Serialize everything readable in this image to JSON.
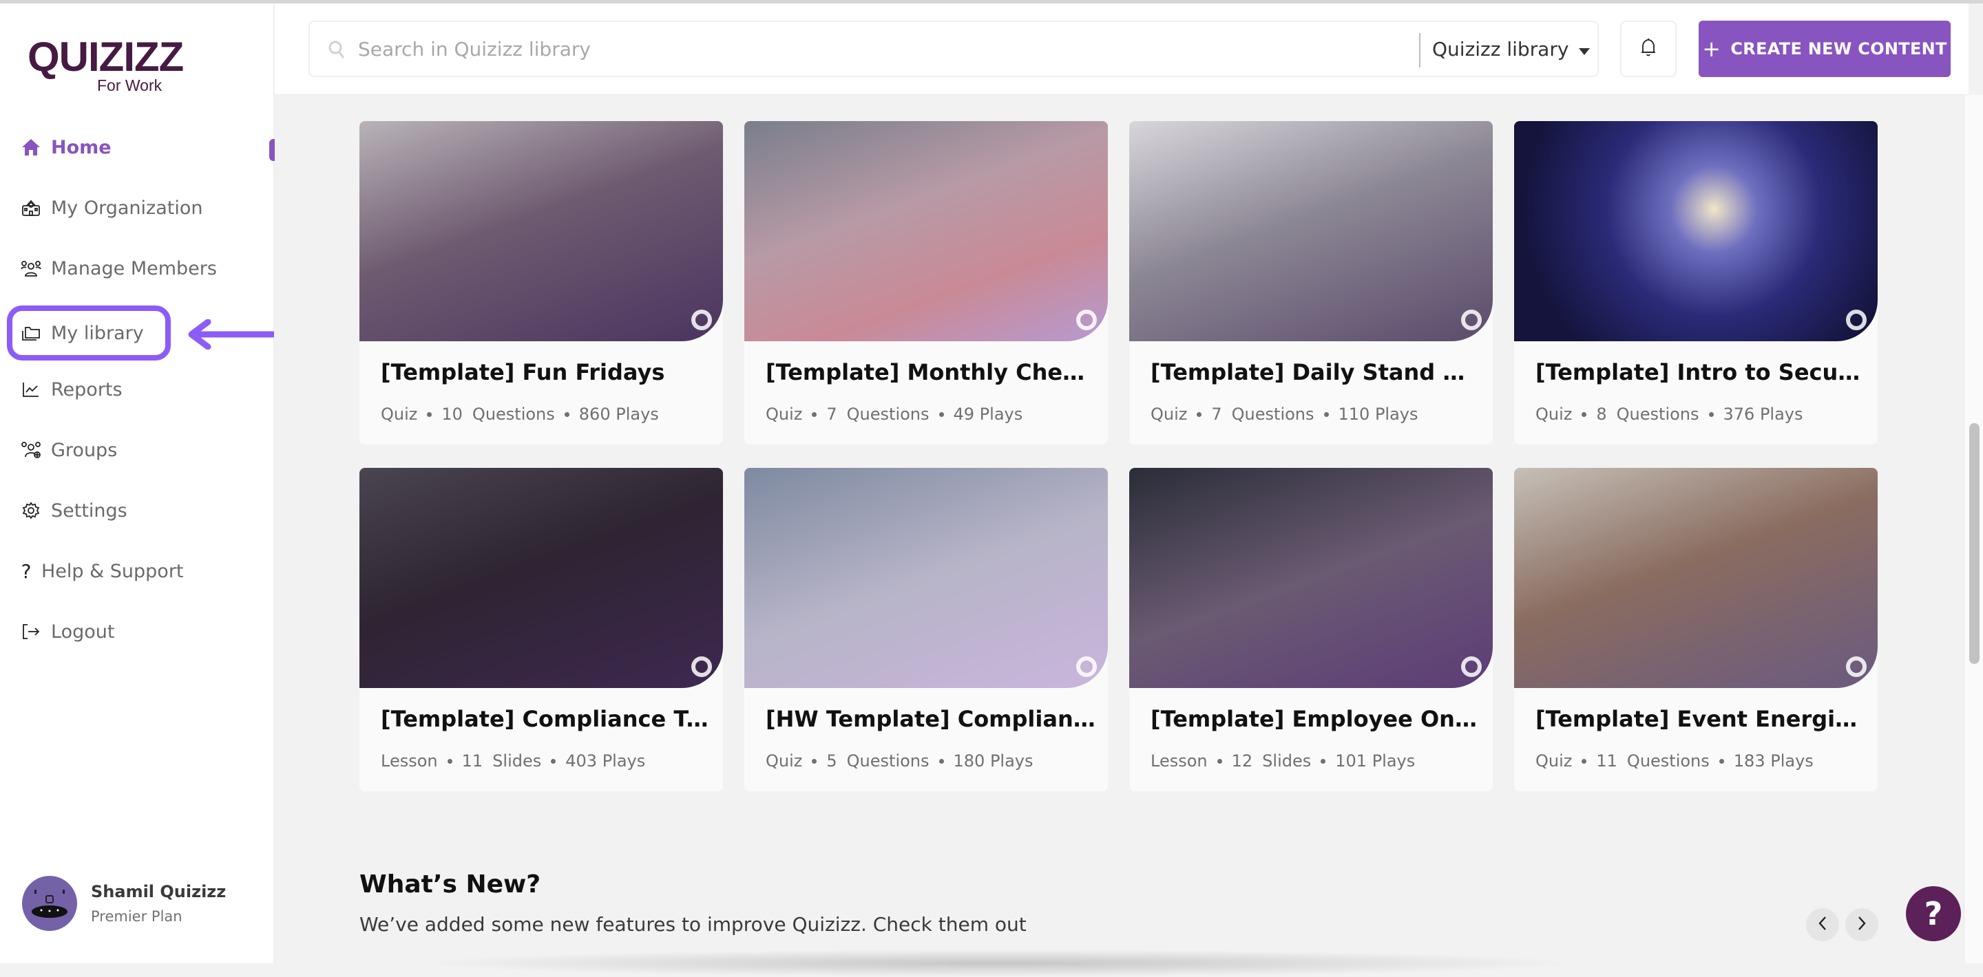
{
  "app": {
    "logo_main": "QUIZIZZ",
    "logo_sub": "For Work",
    "brand_color": "#8854c0",
    "logo_color": "#461a42"
  },
  "sidebar": {
    "items": [
      {
        "label": "Home",
        "icon": "home-icon",
        "active": true
      },
      {
        "label": "My Organization",
        "icon": "school-building-icon",
        "active": false
      },
      {
        "label": "Manage Members",
        "icon": "users-icon",
        "active": false
      },
      {
        "label": "My library",
        "icon": "folder-icon",
        "active": false
      },
      {
        "label": "Reports",
        "icon": "line-chart-icon",
        "active": false
      },
      {
        "label": "Groups",
        "icon": "group-add-icon",
        "active": false
      },
      {
        "label": "Settings",
        "icon": "gear-icon",
        "active": false
      },
      {
        "label": "Help & Support",
        "icon": "question-icon",
        "active": false
      },
      {
        "label": "Logout",
        "icon": "logout-icon",
        "active": false
      }
    ],
    "annotation_color": "#8c5cf6",
    "user": {
      "name": "Shamil Quizizz",
      "plan": "Premier Plan"
    }
  },
  "topbar": {
    "search_placeholder": "Search in Quizizz library",
    "search_value": "",
    "library_select": "Quizizz library",
    "create_label": "CREATE NEW CONTENT"
  },
  "cards": [
    {
      "title": "[Template] Fun Fridays",
      "type": "Quiz",
      "count": "10",
      "unit": "Questions",
      "plays": "860 Plays"
    },
    {
      "title": "[Template] Monthly Check in...",
      "type": "Quiz",
      "count": "7",
      "unit": "Questions",
      "plays": "49 Plays"
    },
    {
      "title": "[Template] Daily Stand Ups",
      "type": "Quiz",
      "count": "7",
      "unit": "Questions",
      "plays": "110 Plays"
    },
    {
      "title": "[Template] Intro to Security ...",
      "type": "Quiz",
      "count": "8",
      "unit": "Questions",
      "plays": "376 Plays"
    },
    {
      "title": "[Template] Compliance Train...",
      "type": "Lesson",
      "count": "11",
      "unit": "Slides",
      "plays": "403 Plays"
    },
    {
      "title": "[HW Template] Compliance T...",
      "type": "Quiz",
      "count": "5",
      "unit": "Questions",
      "plays": "180 Plays"
    },
    {
      "title": "[Template] Employee Onboa...",
      "type": "Lesson",
      "count": "12",
      "unit": "Slides",
      "plays": "101 Plays"
    },
    {
      "title": "[Template] Event Energizer",
      "type": "Quiz",
      "count": "11",
      "unit": "Questions",
      "plays": "183 Plays"
    }
  ],
  "whats_new": {
    "title": "What’s New?",
    "subtitle": "We’ve added some new features to improve Quizizz. Check them out"
  },
  "help_button": "?"
}
